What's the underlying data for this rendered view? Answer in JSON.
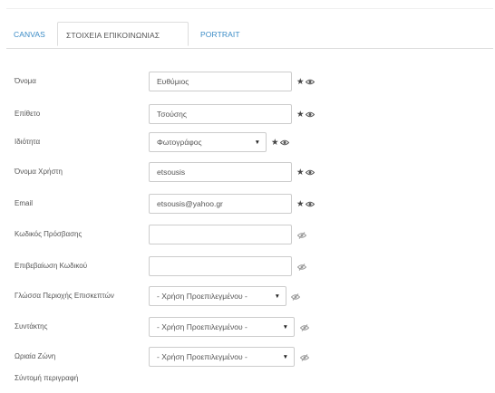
{
  "tabs": [
    {
      "label": "CANVAS",
      "active": false
    },
    {
      "label": "ΣΤΟΙΧΕΙΑ ΕΠΙΚΟΙΝΩΝΙΑΣ",
      "active": true
    },
    {
      "label": "PORTRAIT",
      "active": false
    }
  ],
  "form": {
    "first_name": {
      "label": "Όνομα",
      "value": "Ευθύμιος"
    },
    "last_name": {
      "label": "Επίθετο",
      "value": "Τσούσης"
    },
    "occupation": {
      "label": "Ιδιότητα",
      "value": "Φωτογράφος"
    },
    "username": {
      "label": "Όνομα Χρήστη",
      "value": "etsousis"
    },
    "email": {
      "label": "Email",
      "value": "etsousis@yahoo.gr"
    },
    "password": {
      "label": "Κωδικός Πρόσβασης",
      "value": ""
    },
    "password_confirm": {
      "label": "Επιβεβαίωση Κωδικού",
      "value": ""
    },
    "site_language": {
      "label": "Γλώσσα Περιοχής Επισκεπτών",
      "value": "- Χρήση Προεπιλεγμένου -"
    },
    "editor": {
      "label": "Συντάκτης",
      "value": "- Χρήση Προεπιλεγμένου -"
    },
    "timezone": {
      "label": "Ωριαία Ζώνη",
      "value": "- Χρήση Προεπιλεγμένου -"
    },
    "short_description": {
      "label": "Σύντομή περιγραφή"
    }
  },
  "icons": {
    "star": "star-icon",
    "eye": "eye-icon",
    "caret": "caret-down-icon"
  },
  "colors": {
    "link": "#3a8bc6",
    "text": "#555555",
    "border": "#cccccc"
  }
}
